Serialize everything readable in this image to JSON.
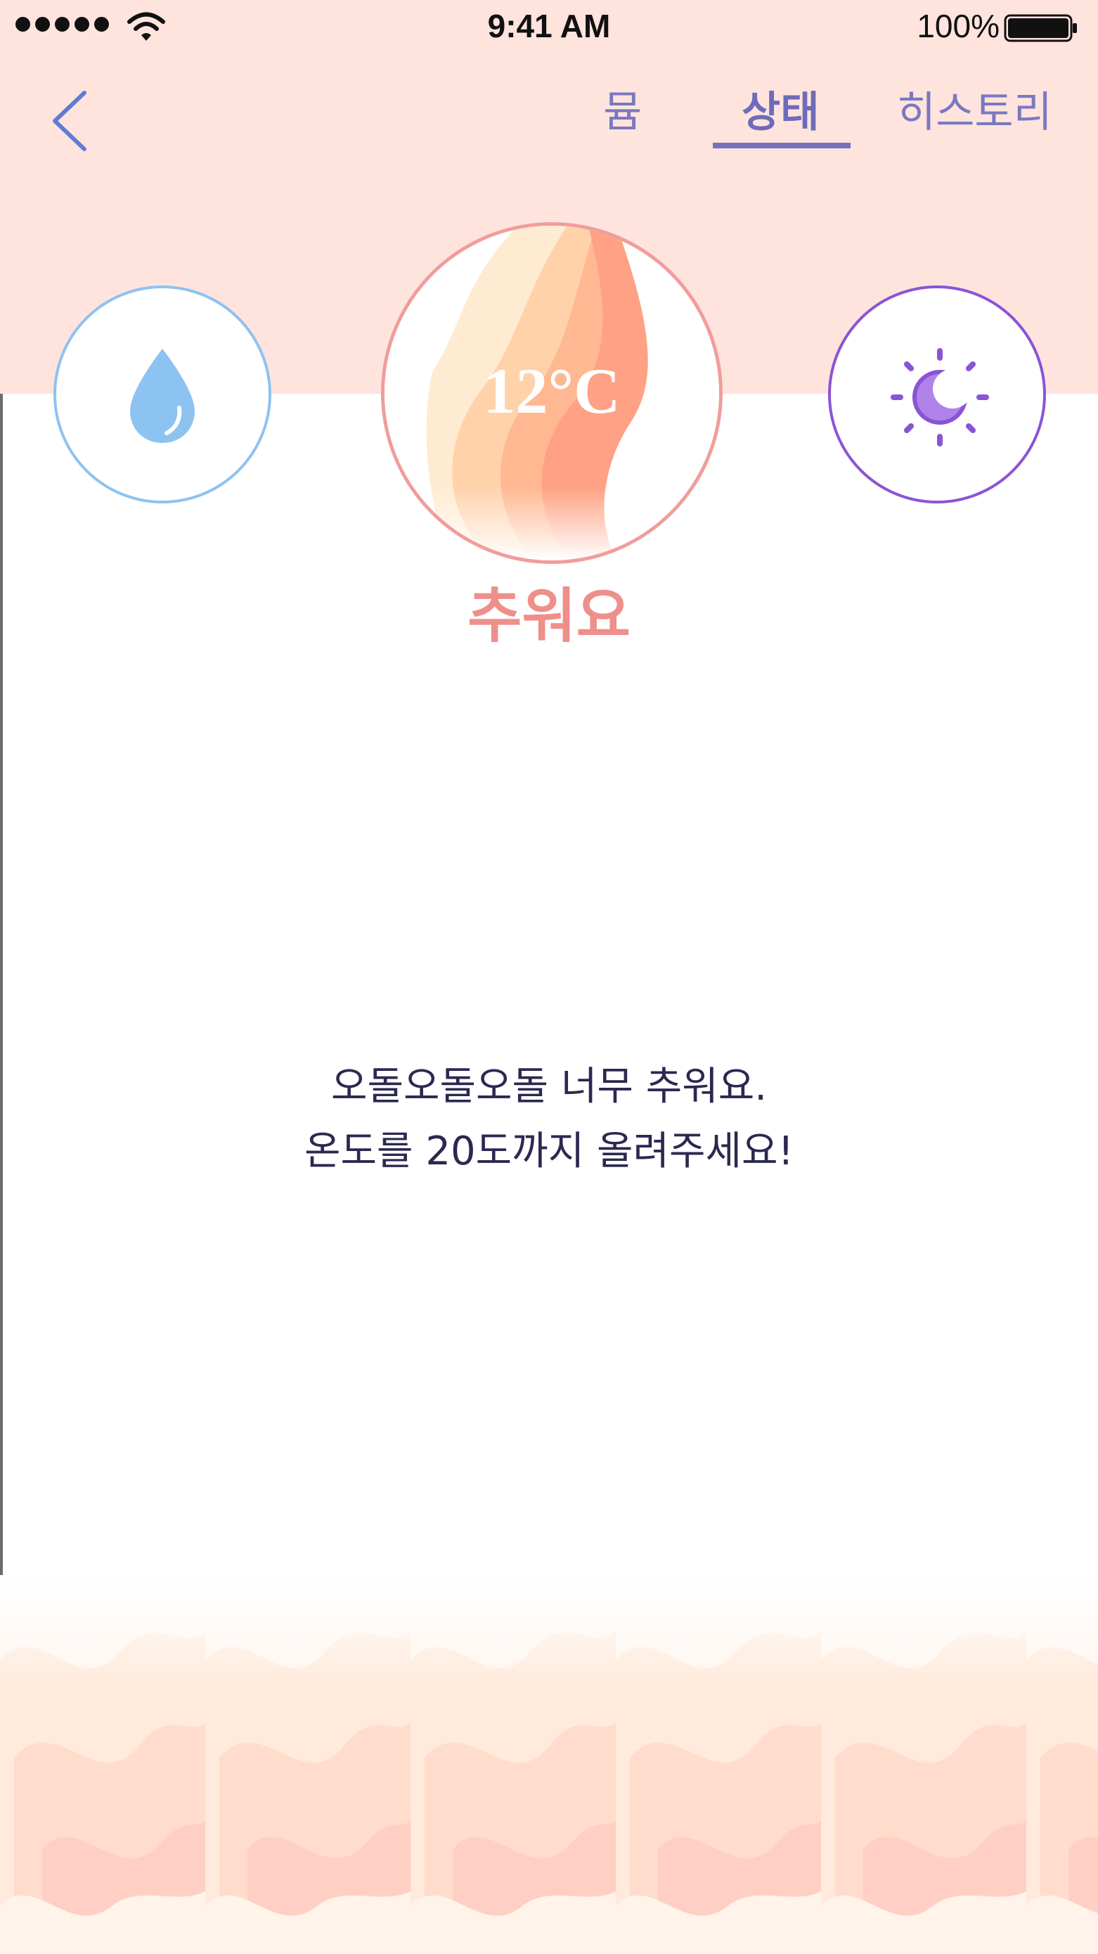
{
  "status_bar": {
    "time": "9:41 AM",
    "battery": "100%"
  },
  "nav": {
    "tabs": [
      {
        "label": "뮴",
        "selected": false
      },
      {
        "label": "상태",
        "selected": true
      },
      {
        "label": "히스토리",
        "selected": false
      }
    ]
  },
  "indicators": {
    "humidity_icon": "water-drop-icon",
    "light_icon": "sun-moon-icon",
    "temperature": "12°C"
  },
  "status": {
    "label": "추워요"
  },
  "message": {
    "line1": "오돌오돌오돌 너무 추워요.",
    "line2": "온도를 20도까지 올려주세요!"
  },
  "colors": {
    "header_bg": "#FFE4DE",
    "accent": "#7472BC",
    "humidity": "#8DC3F1",
    "light": "#8A54D6",
    "warm": "#F09D9C"
  }
}
